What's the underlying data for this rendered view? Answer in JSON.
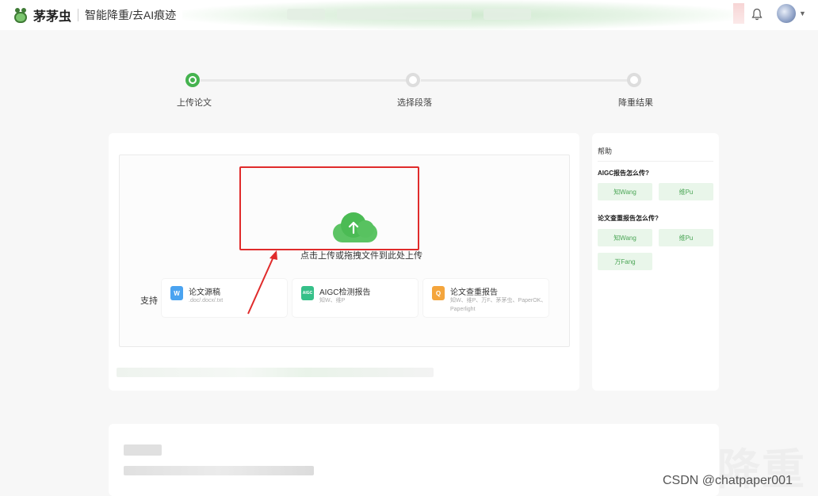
{
  "header": {
    "brand": "茅茅虫",
    "subtitle": "智能降重/去AI痕迹"
  },
  "steps": [
    {
      "label": "上传论文",
      "active": true
    },
    {
      "label": "选择段落",
      "active": false
    },
    {
      "label": "降重结果",
      "active": false
    }
  ],
  "upload": {
    "prompt": "点击上传或拖拽文件到此处上传",
    "support_label": "支持",
    "types": [
      {
        "title": "论文源稿",
        "sub": ".doc/.docx/.txt",
        "icon": "word-doc-icon",
        "color": "#4aa3f0",
        "glyph": "W"
      },
      {
        "title": "AIGC检测报告",
        "sub": "知W、维P",
        "icon": "aigc-report-icon",
        "color": "#36c089",
        "glyph": "AIGC"
      },
      {
        "title": "论文查重报告",
        "sub": "知W、维P、万F、茅茅虫、PaperOK、Paperlight",
        "icon": "plagiarism-report-icon",
        "color": "#f4a53c",
        "glyph": "Q"
      }
    ]
  },
  "help": {
    "title": "帮助",
    "q1": "AIGC报告怎么传?",
    "q1_tags": [
      "知Wang",
      "维Pu"
    ],
    "q2": "论文查重报告怎么传?",
    "q2_tags": [
      "知Wang",
      "维Pu",
      "万Fang"
    ]
  },
  "watermark": "CSDN @chatpaper001",
  "bg_text": "降重"
}
